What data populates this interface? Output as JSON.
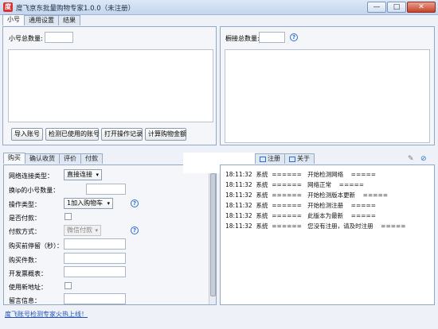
{
  "window": {
    "title": "度飞京东批量购物专家1.0.0（未注册）",
    "minimize": "—",
    "maximize": "□",
    "close": "✕"
  },
  "main_tabs": [
    "小号",
    "通用设置",
    "结果"
  ],
  "left_panel": {
    "count_label": "小号总数量:",
    "count_value": "",
    "buttons": [
      "导入账号",
      "检测已使用的账号",
      "打开操作记录",
      "计算购物金额"
    ]
  },
  "right_panel": {
    "count_label": "橱接总数量:",
    "count_value": ""
  },
  "bottom_tabs": [
    "购买",
    "确认收货",
    "评价",
    "付款"
  ],
  "form": {
    "connection_type": {
      "label": "网络连接类型：",
      "value": "直接连接"
    },
    "per_ip": {
      "label": "换ip的小号数量：",
      "value": ""
    },
    "operation_type": {
      "label": "操作类型：",
      "value": "1加入购物车"
    },
    "pay_checkbox": {
      "label": "是否付款："
    },
    "pay_method": {
      "label": "付款方式：",
      "value": "微信付款"
    },
    "wait_before_buy": {
      "label": "购买前停留（秒）：",
      "value": ""
    },
    "buy_quantity": {
      "label": "购买件数：",
      "value": ""
    },
    "invoice_header": {
      "label": "开发票概表：",
      "value": ""
    },
    "new_address": {
      "label": "使用新地址："
    },
    "message": {
      "label": "留言信息：",
      "value": ""
    }
  },
  "log_tabs": [
    "注册",
    "关于"
  ],
  "log_entries": [
    {
      "time": "18:11:32",
      "source": "系统",
      "sep1": "======",
      "message": "开始检测网络",
      "sep2": "====="
    },
    {
      "time": "18:11:32",
      "source": "系统",
      "sep1": "======",
      "message": "网络正常",
      "sep2": "====="
    },
    {
      "time": "18:11:32",
      "source": "系统",
      "sep1": "======",
      "message": "开始检测版本更新",
      "sep2": "====="
    },
    {
      "time": "18:11:32",
      "source": "系统",
      "sep1": "======",
      "message": "开始检测注册",
      "sep2": "====="
    },
    {
      "time": "18:11:32",
      "source": "系统",
      "sep1": "======",
      "message": "此版本为最新",
      "sep2": "====="
    },
    {
      "time": "18:11:32",
      "source": "系统",
      "sep1": "======",
      "message": "您没有注册，请及时注册",
      "sep2": "====="
    }
  ],
  "footer_link": "度飞账号检测专家火热上线！",
  "colors": {
    "link": "#1f4fb5",
    "help": "#2d6fc9",
    "app_icon": "#d83232"
  }
}
